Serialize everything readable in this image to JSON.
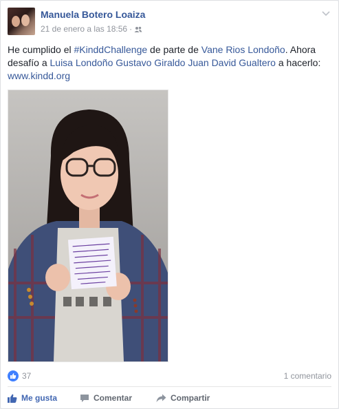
{
  "post": {
    "author": "Manuela Botero Loaiza",
    "timestamp": "21 de enero a las 18:56",
    "separator": "·",
    "audience_icon": "friends-icon",
    "text": {
      "part1": "He cumplido el ",
      "hashtag": "#KinddChallenge",
      "part2": " de parte de ",
      "tag_from": "Vane Rios Londoño",
      "part3": ". Ahora desafío a ",
      "tag1": "Luisa Londoño",
      "tag2": "Gustavo Giraldo",
      "tag3": "Juan David Gualtero",
      "part4": " a hacerlo: ",
      "link": "www.kindd.org"
    },
    "photo_sign_text": "LA VIDA TIENE DIFERENTES CAPITULOS, UN MAL CAPITULO NO SIGNIFICA EL FINAL DE LA HISTORIA"
  },
  "stats": {
    "likes": "37",
    "comments": "1 comentario"
  },
  "actions": {
    "like": "Me gusta",
    "comment": "Comentar",
    "share": "Compartir"
  },
  "colors": {
    "link": "#365899",
    "like_blue": "#4267b2",
    "badge": "#4080ff",
    "meta_gray": "#90949c"
  }
}
